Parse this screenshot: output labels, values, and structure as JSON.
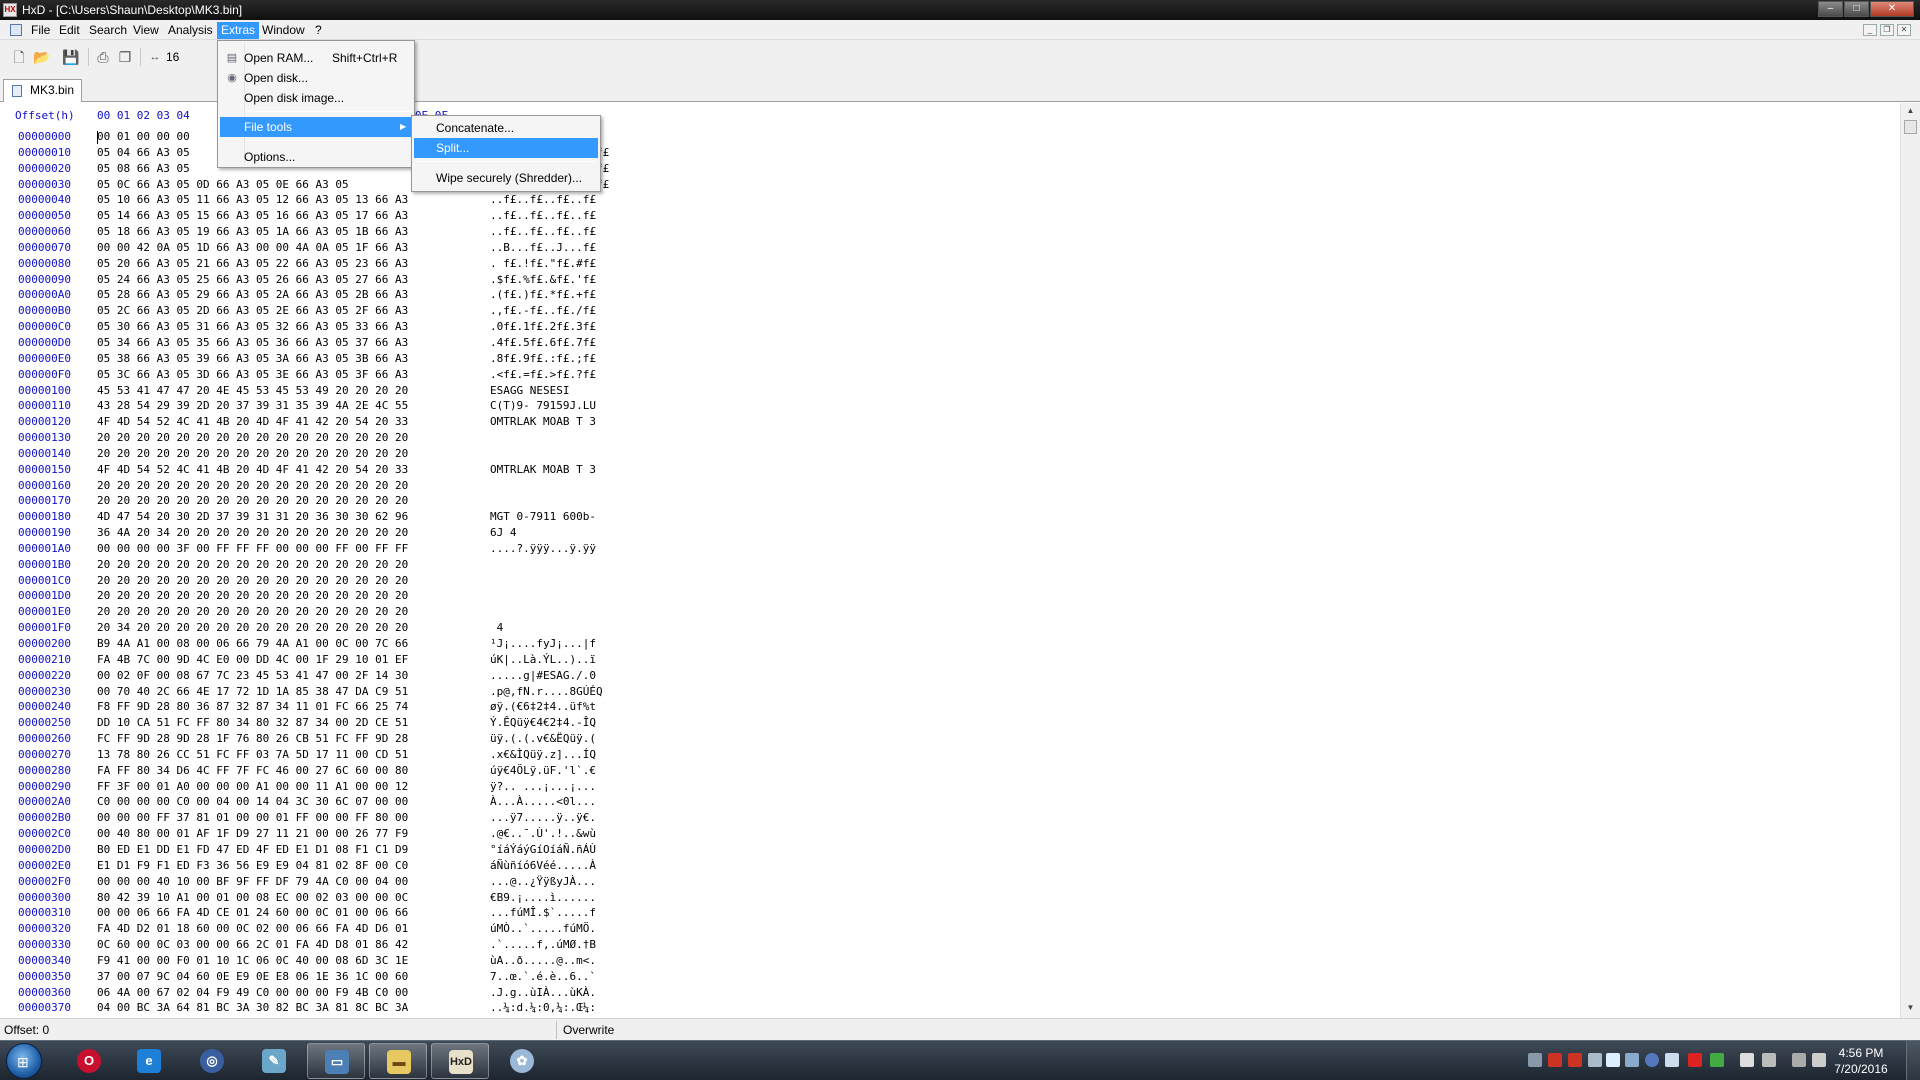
{
  "window": {
    "title": "HxD - [C:\\Users\\Shaun\\Desktop\\MK3.bin]",
    "minimize": "–",
    "maximize": "□",
    "close": "✕"
  },
  "menubar": {
    "items": [
      "File",
      "Edit",
      "Search",
      "View",
      "Analysis",
      "Extras",
      "Window",
      "?"
    ],
    "active": "Extras"
  },
  "toolbar": {
    "bytes_per_row": "16",
    "icons": [
      "new-file-icon",
      "open-file-icon",
      "save-icon",
      "print-icon",
      "copy-icon",
      "bytes-per-row-icon"
    ]
  },
  "tab": {
    "label": "MK3.bin"
  },
  "editor": {
    "offset_header": "Offset(h)",
    "column_header": "00 01 02 03 04",
    "column_header_tail": "0D 0E 0F",
    "rows": [
      {
        "o": "00000000",
        "h": "00 01 00 00 00 ",
        "a": ""
      },
      {
        "o": "00000010",
        "h": "05 04 66 A3 05 ",
        "a": "                f£"
      },
      {
        "o": "00000020",
        "h": "05 08 66 A3 05 ",
        "a": "                f£"
      },
      {
        "o": "00000030",
        "h": "05 0C 66 A3 05 0D 66 A3 05 0E 66 A3 05 ",
        "a": "                f£"
      },
      {
        "o": "00000040",
        "h": "05 10 66 A3 05 11 66 A3 05 12 66 A3 05 13 66 A3",
        "a": "..f£..f£..f£..f£"
      },
      {
        "o": "00000050",
        "h": "05 14 66 A3 05 15 66 A3 05 16 66 A3 05 17 66 A3",
        "a": "..f£..f£..f£..f£"
      },
      {
        "o": "00000060",
        "h": "05 18 66 A3 05 19 66 A3 05 1A 66 A3 05 1B 66 A3",
        "a": "..f£..f£..f£..f£"
      },
      {
        "o": "00000070",
        "h": "00 00 42 0A 05 1D 66 A3 00 00 4A 0A 05 1F 66 A3",
        "a": "..B...f£..J...f£"
      },
      {
        "o": "00000080",
        "h": "05 20 66 A3 05 21 66 A3 05 22 66 A3 05 23 66 A3",
        "a": ". f£.!f£.\"f£.#f£"
      },
      {
        "o": "00000090",
        "h": "05 24 66 A3 05 25 66 A3 05 26 66 A3 05 27 66 A3",
        "a": ".$f£.%f£.&f£.'f£"
      },
      {
        "o": "000000A0",
        "h": "05 28 66 A3 05 29 66 A3 05 2A 66 A3 05 2B 66 A3",
        "a": ".(f£.)f£.*f£.+f£"
      },
      {
        "o": "000000B0",
        "h": "05 2C 66 A3 05 2D 66 A3 05 2E 66 A3 05 2F 66 A3",
        "a": ".,f£.-f£..f£./f£"
      },
      {
        "o": "000000C0",
        "h": "05 30 66 A3 05 31 66 A3 05 32 66 A3 05 33 66 A3",
        "a": ".0f£.1f£.2f£.3f£"
      },
      {
        "o": "000000D0",
        "h": "05 34 66 A3 05 35 66 A3 05 36 66 A3 05 37 66 A3",
        "a": ".4f£.5f£.6f£.7f£"
      },
      {
        "o": "000000E0",
        "h": "05 38 66 A3 05 39 66 A3 05 3A 66 A3 05 3B 66 A3",
        "a": ".8f£.9f£.:f£.;f£"
      },
      {
        "o": "000000F0",
        "h": "05 3C 66 A3 05 3D 66 A3 05 3E 66 A3 05 3F 66 A3",
        "a": ".<f£.=f£.>f£.?f£"
      },
      {
        "o": "00000100",
        "h": "45 53 41 47 47 20 4E 45 53 45 53 49 20 20 20 20",
        "a": "ESAGG NESESI    "
      },
      {
        "o": "00000110",
        "h": "43 28 54 29 39 2D 20 37 39 31 35 39 4A 2E 4C 55",
        "a": "C(T)9- 79159J.LU"
      },
      {
        "o": "00000120",
        "h": "4F 4D 54 52 4C 41 4B 20 4D 4F 41 42 20 54 20 33",
        "a": "OMTRLAK MOAB T 3"
      },
      {
        "o": "00000130",
        "h": "20 20 20 20 20 20 20 20 20 20 20 20 20 20 20 20",
        "a": ""
      },
      {
        "o": "00000140",
        "h": "20 20 20 20 20 20 20 20 20 20 20 20 20 20 20 20",
        "a": ""
      },
      {
        "o": "00000150",
        "h": "4F 4D 54 52 4C 41 4B 20 4D 4F 41 42 20 54 20 33",
        "a": "OMTRLAK MOAB T 3"
      },
      {
        "o": "00000160",
        "h": "20 20 20 20 20 20 20 20 20 20 20 20 20 20 20 20",
        "a": ""
      },
      {
        "o": "00000170",
        "h": "20 20 20 20 20 20 20 20 20 20 20 20 20 20 20 20",
        "a": ""
      },
      {
        "o": "00000180",
        "h": "4D 47 54 20 30 2D 37 39 31 31 20 36 30 30 62 96",
        "a": "MGT 0-7911 600b-"
      },
      {
        "o": "00000190",
        "h": "36 4A 20 34 20 20 20 20 20 20 20 20 20 20 20 20",
        "a": "6J 4"
      },
      {
        "o": "000001A0",
        "h": "00 00 00 00 3F 00 FF FF FF 00 00 00 FF 00 FF FF",
        "a": "....?.ÿÿÿ...ÿ.ÿÿ"
      },
      {
        "o": "000001B0",
        "h": "20 20 20 20 20 20 20 20 20 20 20 20 20 20 20 20",
        "a": ""
      },
      {
        "o": "000001C0",
        "h": "20 20 20 20 20 20 20 20 20 20 20 20 20 20 20 20",
        "a": ""
      },
      {
        "o": "000001D0",
        "h": "20 20 20 20 20 20 20 20 20 20 20 20 20 20 20 20",
        "a": ""
      },
      {
        "o": "000001E0",
        "h": "20 20 20 20 20 20 20 20 20 20 20 20 20 20 20 20",
        "a": ""
      },
      {
        "o": "000001F0",
        "h": "20 34 20 20 20 20 20 20 20 20 20 20 20 20 20 20",
        "a": " 4"
      },
      {
        "o": "00000200",
        "h": "B9 4A A1 00 08 00 06 66 79 4A A1 00 0C 00 7C 66",
        "a": "¹J¡....fyJ¡...|f"
      },
      {
        "o": "00000210",
        "h": "FA 4B 7C 00 9D 4C E0 00 DD 4C 00 1F 29 10 01 EF",
        "a": "úK|..Là.ÝL..)..ï"
      },
      {
        "o": "00000220",
        "h": "00 02 0F 00 08 67 7C 23 45 53 41 47 00 2F 14 30",
        "a": ".....g|#ESAG./.0"
      },
      {
        "o": "00000230",
        "h": "00 70 40 2C 66 4E 17 72 1D 1A 85 38 47 DA C9 51",
        "a": ".p@,fN.r....8GÚÉQ"
      },
      {
        "o": "00000240",
        "h": "F8 FF 9D 28 80 36 87 32 87 34 11 01 FC 66 25 74",
        "a": "øÿ.(€6‡2‡4..üf%t"
      },
      {
        "o": "00000250",
        "h": "DD 10 CA 51 FC FF 80 34 80 32 87 34 00 2D CE 51",
        "a": "Ý.ÊQüÿ€4€2‡4.-ÎQ"
      },
      {
        "o": "00000260",
        "h": "FC FF 9D 28 9D 28 1F 76 80 26 CB 51 FC FF 9D 28",
        "a": "üÿ.(.(.v€&ËQüÿ.("
      },
      {
        "o": "00000270",
        "h": "13 78 80 26 CC 51 FC FF 03 7A 5D 17 11 00 CD 51",
        "a": ".x€&ÌQüÿ.z]...ÍQ"
      },
      {
        "o": "00000280",
        "h": "FA FF 80 34 D6 4C FF 7F FC 46 00 27 6C 60 00 80",
        "a": "úÿ€4ÖLÿ.üF.'l`.€"
      },
      {
        "o": "00000290",
        "h": "FF 3F 00 01 A0 00 00 00 A1 00 00 11 A1 00 00 12",
        "a": "ÿ?.. ...¡...¡..."
      },
      {
        "o": "000002A0",
        "h": "C0 00 00 00 C0 00 04 00 14 04 3C 30 6C 07 00 00",
        "a": "À...À.....<0l..."
      },
      {
        "o": "000002B0",
        "h": "00 00 00 FF 37 81 01 00 00 01 FF 00 00 FF 80 00",
        "a": "...ÿ7.....ÿ..ÿ€."
      },
      {
        "o": "000002C0",
        "h": "00 40 80 00 01 AF 1F D9 27 11 21 00 00 26 77 F9",
        "a": ".@€..¯.Ù'.!..&wù"
      },
      {
        "o": "000002D0",
        "h": "B0 ED E1 DD E1 FD 47 ED 4F ED E1 D1 08 F1 C1 D9",
        "a": "°íáÝáýGíOíáÑ.ñÁÙ"
      },
      {
        "o": "000002E0",
        "h": "E1 D1 F9 F1 ED F3 36 56 E9 E9 04 81 02 8F 00 C0",
        "a": "áÑùñíó6Véé.....À"
      },
      {
        "o": "000002F0",
        "h": "00 00 00 40 10 00 BF 9F FF DF 79 4A C0 00 04 00",
        "a": "...@..¿ŸÿßyJÀ..."
      },
      {
        "o": "00000300",
        "h": "80 42 39 10 A1 00 01 00 08 EC 00 02 03 00 00 0C",
        "a": "€B9.¡....ì......"
      },
      {
        "o": "00000310",
        "h": "00 00 06 66 FA 4D CE 01 24 60 00 0C 01 00 06 66",
        "a": "...fúMÎ.$`.....f"
      },
      {
        "o": "00000320",
        "h": "FA 4D D2 01 18 60 00 0C 02 00 06 66 FA 4D D6 01",
        "a": "úMÒ..`.....fúMÖ."
      },
      {
        "o": "00000330",
        "h": "0C 60 00 0C 03 00 00 66 2C 01 FA 4D D8 01 86 42",
        "a": ".`.....f,.úMØ.†B"
      },
      {
        "o": "00000340",
        "h": "F9 41 00 00 F0 01 10 1C 06 0C 40 00 08 6D 3C 1E",
        "a": "ùA..ð.....@..m<."
      },
      {
        "o": "00000350",
        "h": "37 00 07 9C 04 60 0E E9 0E E8 06 1E 36 1C 00 60",
        "a": "7..œ.`.é.è..6..`"
      },
      {
        "o": "00000360",
        "h": "06 4A 00 67 02 04 F9 49 C0 00 00 00 F9 4B C0 00",
        "a": ".J.g..ùIÀ...ùKÀ."
      },
      {
        "o": "00000370",
        "h": "04 00 BC 3A 64 81 BC 3A 30 82 BC 3A 81 8C BC 3A",
        "a": "..¼:d.¼:0‚¼:.Œ¼:"
      }
    ]
  },
  "extras_menu": {
    "items": [
      {
        "label": "Open RAM...",
        "shortcut": "Shift+Ctrl+R",
        "icon": "ram-icon"
      },
      {
        "label": "Open disk...",
        "icon": "disk-icon"
      },
      {
        "label": "Open disk image..."
      },
      {
        "label": "File tools",
        "submenu": true,
        "highlighted": true
      },
      {
        "label": "Options..."
      }
    ]
  },
  "filetools_menu": {
    "items": [
      {
        "label": "Concatenate..."
      },
      {
        "label": "Split...",
        "highlighted": true
      },
      {
        "label": "Wipe securely (Shredder)..."
      }
    ]
  },
  "statusbar": {
    "offset": "Offset: 0",
    "mode": "Overwrite"
  },
  "taskbar": {
    "apps": [
      "opera-icon",
      "internet-explorer-icon",
      "app-icon",
      "notepad-icon",
      "explorer-window-icon",
      "file-explorer-icon",
      "hxd-icon",
      "paint-icon"
    ],
    "clock_time": "4:56 PM",
    "clock_date": "7/20/2016",
    "accent": "#3399ff"
  }
}
